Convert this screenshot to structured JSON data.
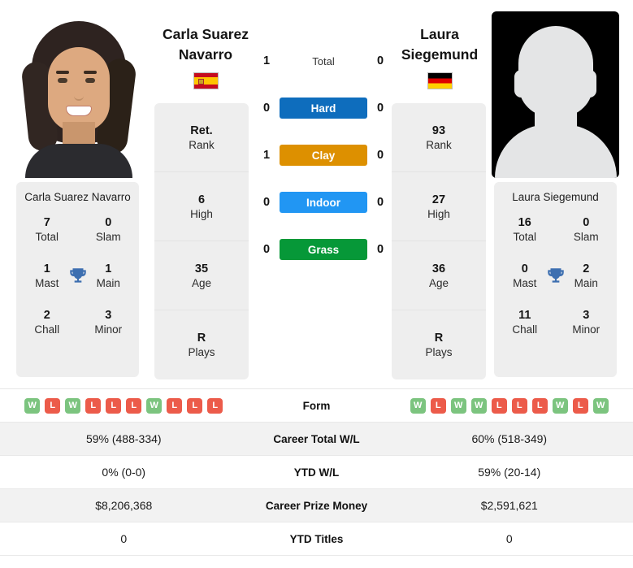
{
  "players": {
    "left": {
      "name": "Carla Suarez Navarro",
      "name_line1": "Carla Suarez",
      "name_line2": "Navarro",
      "country_flag": "spain-flag",
      "photo": "player-photo",
      "rank": "Ret.",
      "rank_label": "Rank",
      "high": "6",
      "high_label": "High",
      "age": "35",
      "age_label": "Age",
      "plays": "R",
      "plays_label": "Plays",
      "titles": {
        "total": "7",
        "total_label": "Total",
        "slam": "0",
        "slam_label": "Slam",
        "mast": "1",
        "mast_label": "Mast",
        "main": "1",
        "main_label": "Main",
        "chall": "2",
        "chall_label": "Chall",
        "minor": "3",
        "minor_label": "Minor"
      },
      "form": [
        "W",
        "L",
        "W",
        "L",
        "L",
        "L",
        "W",
        "L",
        "L",
        "L"
      ],
      "career_wl": "59% (488-334)",
      "ytd_wl": "0% (0-0)",
      "career_prize": "$8,206,368",
      "ytd_titles": "0"
    },
    "right": {
      "name": "Laura Siegemund",
      "name_line1": "Laura",
      "name_line2": "Siegemund",
      "country_flag": "germany-flag",
      "photo": "player-photo-placeholder",
      "rank": "93",
      "rank_label": "Rank",
      "high": "27",
      "high_label": "High",
      "age": "36",
      "age_label": "Age",
      "plays": "R",
      "plays_label": "Plays",
      "titles": {
        "total": "16",
        "total_label": "Total",
        "slam": "0",
        "slam_label": "Slam",
        "mast": "0",
        "mast_label": "Mast",
        "main": "2",
        "main_label": "Main",
        "chall": "11",
        "chall_label": "Chall",
        "minor": "3",
        "minor_label": "Minor"
      },
      "form": [
        "W",
        "L",
        "W",
        "W",
        "L",
        "L",
        "L",
        "W",
        "L",
        "W"
      ],
      "career_wl": "60% (518-349)",
      "ytd_wl": "59% (20-14)",
      "career_prize": "$2,591,621",
      "ytd_titles": "0"
    }
  },
  "head_to_head": [
    {
      "label": "Total",
      "left": "1",
      "right": "0",
      "style": "plain",
      "color": ""
    },
    {
      "label": "Hard",
      "left": "0",
      "right": "0",
      "style": "bar",
      "color": "#0e6dbd"
    },
    {
      "label": "Clay",
      "left": "1",
      "right": "0",
      "style": "bar",
      "color": "#dd9000"
    },
    {
      "label": "Indoor",
      "left": "0",
      "right": "0",
      "style": "bar",
      "color": "#2196f3"
    },
    {
      "label": "Grass",
      "left": "0",
      "right": "0",
      "style": "bar",
      "color": "#069838"
    }
  ],
  "stats_rows": [
    {
      "label": "Form",
      "type": "form"
    },
    {
      "label": "Career Total W/L",
      "type": "text",
      "left": "59% (488-334)",
      "right": "60% (518-349)"
    },
    {
      "label": "YTD W/L",
      "type": "text",
      "left": "0% (0-0)",
      "right": "59% (20-14)"
    },
    {
      "label": "Career Prize Money",
      "type": "text",
      "left": "$8,206,368",
      "right": "$2,591,621"
    },
    {
      "label": "YTD Titles",
      "type": "text",
      "left": "0",
      "right": "0"
    }
  ],
  "colors": {
    "hard": "#0e6dbd",
    "clay": "#dd9000",
    "indoor": "#2196f3",
    "grass": "#069838",
    "win_badge": "#7cc47f",
    "loss_badge": "#ec5b4a",
    "trophy": "#3d6fb0",
    "card_bg": "#eeeeee"
  }
}
